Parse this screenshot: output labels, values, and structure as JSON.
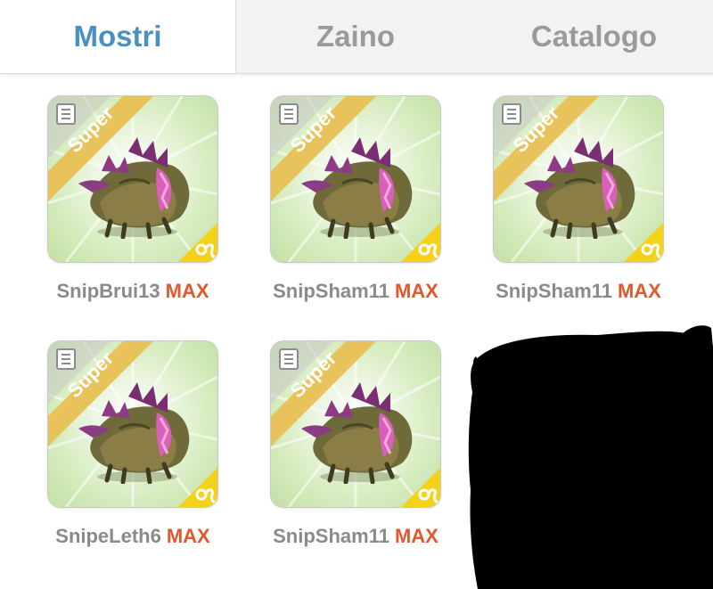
{
  "tabs": [
    {
      "label": "Mostri",
      "active": true
    },
    {
      "label": "Zaino",
      "active": false
    },
    {
      "label": "Catalogo",
      "active": false
    }
  ],
  "ribbon_label": "Super",
  "monsters": [
    {
      "name": "SnipBrui13",
      "level": "MAX"
    },
    {
      "name": "SnipSham11",
      "level": "MAX"
    },
    {
      "name": "SnipSham11",
      "level": "MAX"
    },
    {
      "name": "SnipeLeth6",
      "level": "MAX"
    },
    {
      "name": "SnipSham11",
      "level": "MAX"
    }
  ],
  "colors": {
    "active_tab": "#4a90c0",
    "inactive_tab": "#9a9a9a",
    "max": "#e2572b",
    "ribbon": "#e8c25a",
    "card_bg": "#d6ecbf"
  },
  "icons": [
    "document-icon",
    "leo-zodiac-icon",
    "monster-creature"
  ]
}
